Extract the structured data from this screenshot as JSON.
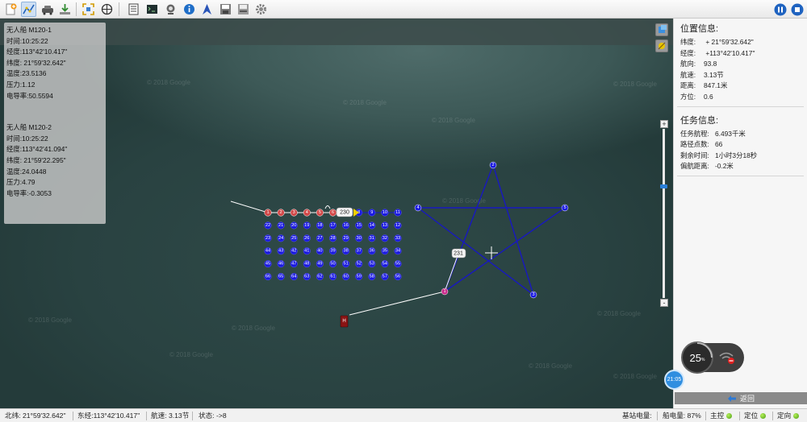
{
  "toolbar": {
    "left_icons": [
      "new-mission-icon",
      "route-edit-icon",
      "vehicle-icon",
      "download-icon",
      "fit-extent-icon",
      "compass-icon",
      "list-icon",
      "terminal-icon",
      "camera-icon",
      "info-icon",
      "navigate-arrow-icon",
      "save-icon",
      "save-as-icon",
      "settings-icon"
    ],
    "right_icons": [
      "pause-icon",
      "stop-icon"
    ]
  },
  "boats": [
    {
      "name": "无人船 M120-1",
      "rows": [
        {
          "label": "时间:",
          "value": "10:25:22"
        },
        {
          "label": "经度:",
          "value": "113°42'10.417\""
        },
        {
          "label": "纬度:",
          "value": " 21°59'32.642\""
        },
        {
          "label": "温度:",
          "value": "23.5136"
        },
        {
          "label": "压力:",
          "value": "1.12"
        },
        {
          "label": "电导率:",
          "value": "50.5594"
        }
      ]
    },
    {
      "name": "无人船 M120-2",
      "rows": [
        {
          "label": "时间:",
          "value": "10:25:22"
        },
        {
          "label": "经度:",
          "value": "113°42'41.094\""
        },
        {
          "label": "纬度:",
          "value": " 21°59'22.295\""
        },
        {
          "label": "温度:",
          "value": "24.0448"
        },
        {
          "label": "压力:",
          "value": "4.79"
        },
        {
          "label": "电导率:",
          "value": "-0.3053"
        }
      ]
    }
  ],
  "map": {
    "watermark": "© 2018 Google",
    "grid_waypoints": [
      [
        "1",
        "2",
        "3",
        "4",
        "5",
        "6",
        "7",
        "8",
        "9",
        "10",
        "11"
      ],
      [
        "22",
        "21",
        "20",
        "19",
        "18",
        "17",
        "16",
        "15",
        "14",
        "13",
        "12"
      ],
      [
        "23",
        "24",
        "25",
        "26",
        "27",
        "28",
        "29",
        "30",
        "31",
        "32",
        "33"
      ],
      [
        "44",
        "43",
        "42",
        "41",
        "40",
        "39",
        "38",
        "37",
        "36",
        "35",
        "34"
      ],
      [
        "45",
        "46",
        "47",
        "48",
        "49",
        "50",
        "51",
        "52",
        "53",
        "54",
        "55"
      ],
      [
        "66",
        "65",
        "64",
        "63",
        "62",
        "61",
        "60",
        "59",
        "58",
        "57",
        "56"
      ]
    ],
    "completed_count": 6,
    "boat1_label": "230",
    "boat2_label": "231",
    "star_points": [
      "1",
      "2",
      "3",
      "4",
      "5"
    ],
    "home_label": "H",
    "colors": {
      "route": "#1010c8",
      "waypoint": "#1a1ae0",
      "done": "#d24848",
      "boat": "#f0d000"
    }
  },
  "position_info": {
    "title": "位置信息:",
    "rows": [
      {
        "label": "纬度:",
        "value": " + 21°59'32.642\""
      },
      {
        "label": "经度:",
        "value": " +113°42'10.417\""
      },
      {
        "label": "航向:",
        "value": "93.8"
      },
      {
        "label": "航速:",
        "value": "3.13节"
      },
      {
        "label": "距离:",
        "value": "847.1米"
      },
      {
        "label": "方位:",
        "value": "0.6"
      }
    ]
  },
  "task_info": {
    "title": "任务信息:",
    "rows": [
      {
        "label": "任务航程:",
        "value": "6.493千米"
      },
      {
        "label": "路径点数:",
        "value": "66"
      },
      {
        "label": "剩余时间:",
        "value": "1小时3分18秒"
      },
      {
        "label": "偏航距离:",
        "value": "-0.2米"
      }
    ]
  },
  "gauge": {
    "percent": "25",
    "unit": "%",
    "level": 0.25
  },
  "clock": "21:05",
  "back_label": "返回",
  "statusbar": {
    "lat": "北纬: 21°59'32.642\"",
    "lon": "东经:113°42'10.417\"",
    "speed": "航速: 3.13节",
    "state": "状态: ->8",
    "base_battery": "基站电量:",
    "boat_battery": "船电量: 87%",
    "main_control": "主控",
    "positioning": "定位",
    "orientation": "定向"
  }
}
